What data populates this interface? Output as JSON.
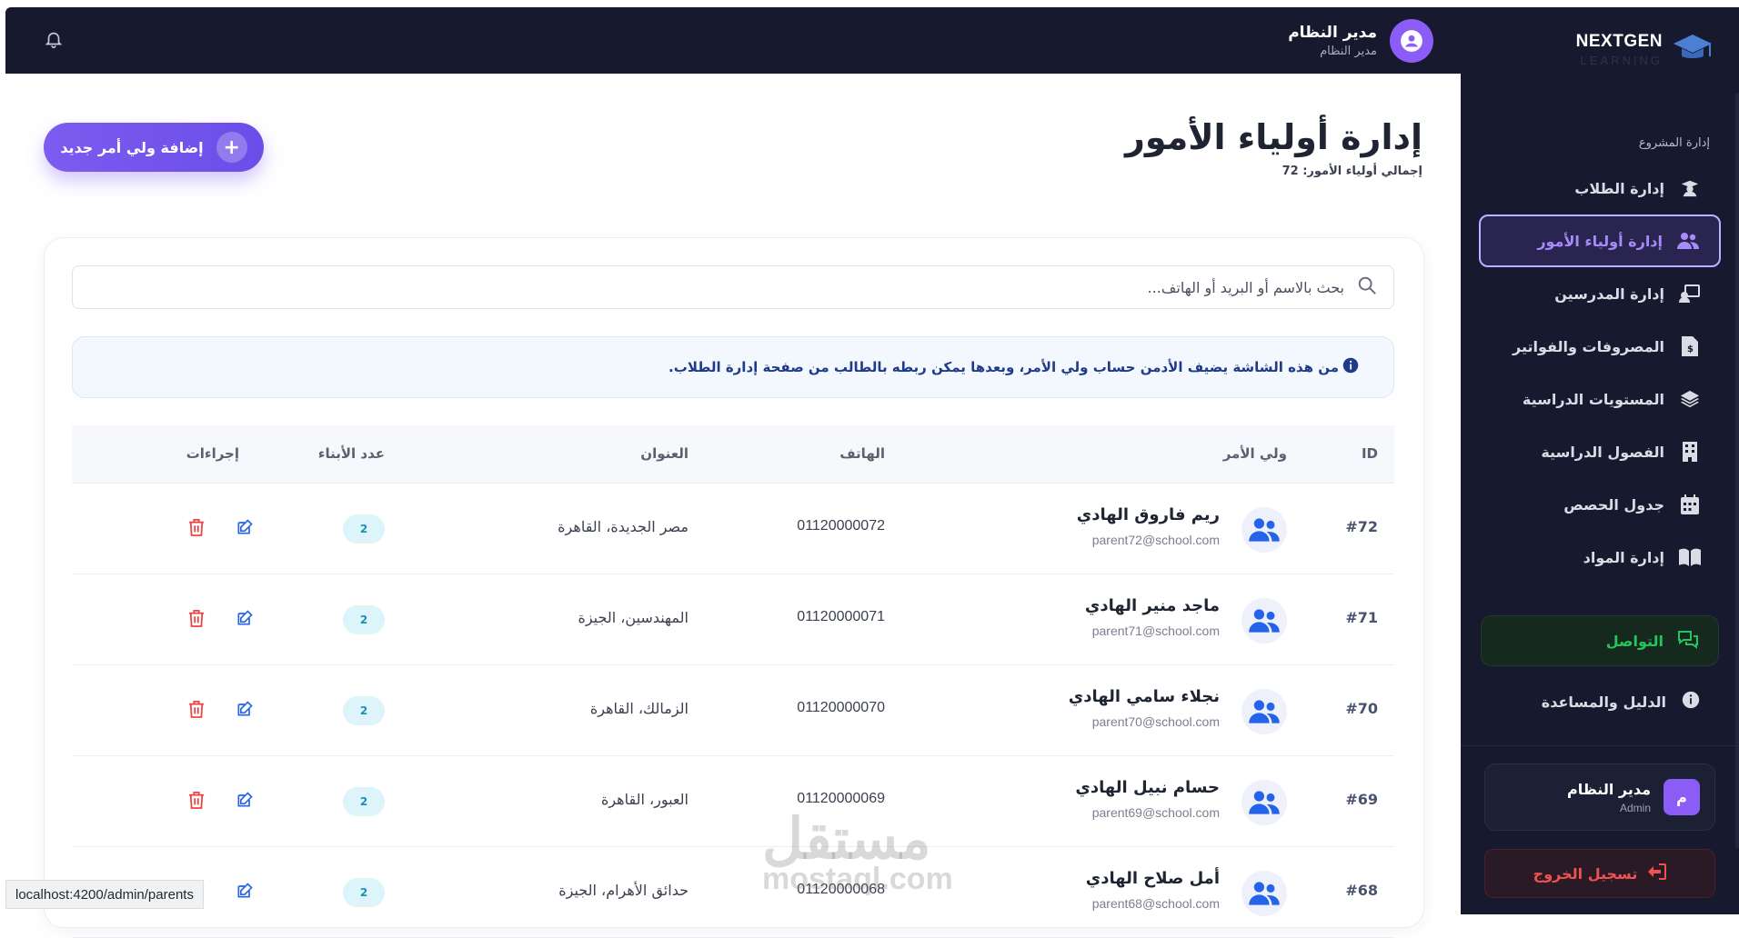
{
  "app": {
    "brand_title": "NEXTGEN",
    "brand_sub": "LEARNING"
  },
  "topbar": {
    "user_name": "مدير النظام",
    "user_role": "مدير النظام"
  },
  "sidebar": {
    "section_label": "إدارة المشروع",
    "items": [
      {
        "label": "إدارة الطلاب",
        "icon": "student-icon"
      },
      {
        "label": "إدارة أولياء الأمور",
        "icon": "users-icon",
        "active": true
      },
      {
        "label": "إدارة المدرسين",
        "icon": "teacher-icon"
      },
      {
        "label": "المصروفات والفواتير",
        "icon": "invoice-icon"
      },
      {
        "label": "المستويات الدراسية",
        "icon": "layers-icon"
      },
      {
        "label": "الفصول الدراسية",
        "icon": "building-icon"
      },
      {
        "label": "جدول الحصص",
        "icon": "calendar-icon"
      },
      {
        "label": "إدارة المواد",
        "icon": "book-icon"
      }
    ],
    "contact_label": "التواصل",
    "help_label": "الدليل والمساعدة",
    "user_card": {
      "name": "مدير النظام",
      "role": "Admin",
      "initial": "م"
    },
    "logout_label": "تسجيل الخروج"
  },
  "page": {
    "title": "إدارة أولياء الأمور",
    "subtitle": "إجمالي أولياء الأمور: 72",
    "add_button": "إضافة ولي أمر جديد",
    "search_placeholder": "بحث بالاسم أو البريد أو الهاتف...",
    "info_message": "من هذه الشاشة يضيف الأدمن حساب ولي الأمر، وبعدها يمكن ربطه بالطالب من صفحة إدارة الطلاب."
  },
  "table": {
    "columns": {
      "id": "ID",
      "parent": "ولي الأمر",
      "phone": "الهاتف",
      "address": "العنوان",
      "kids": "عدد الأبناء",
      "actions": "إجراءات"
    },
    "rows": [
      {
        "id": "#72",
        "name": "ريم فاروق الهادي",
        "email": "parent72@school.com",
        "phone": "01120000072",
        "address": "مصر الجديدة، القاهرة",
        "kids": "2"
      },
      {
        "id": "#71",
        "name": "ماجد منير الهادي",
        "email": "parent71@school.com",
        "phone": "01120000071",
        "address": "المهندسين، الجيزة",
        "kids": "2"
      },
      {
        "id": "#70",
        "name": "نجلاء سامي الهادي",
        "email": "parent70@school.com",
        "phone": "01120000070",
        "address": "الزمالك، القاهرة",
        "kids": "2"
      },
      {
        "id": "#69",
        "name": "حسام نبيل الهادي",
        "email": "parent69@school.com",
        "phone": "01120000069",
        "address": "العبور، القاهرة",
        "kids": "2"
      },
      {
        "id": "#68",
        "name": "أمل صلاح الهادي",
        "email": "parent68@school.com",
        "phone": "01120000068",
        "address": "حدائق الأهرام، الجيزة",
        "kids": "2"
      }
    ]
  },
  "statusbar": {
    "url": "localhost:4200/admin/parents"
  },
  "watermark": {
    "line1": "مستقل",
    "line2": "mostaql.com"
  },
  "colors": {
    "accent": "#7c5cf0",
    "sidebar_bg": "#171a2e",
    "danger": "#f05252",
    "success": "#22c55e"
  }
}
